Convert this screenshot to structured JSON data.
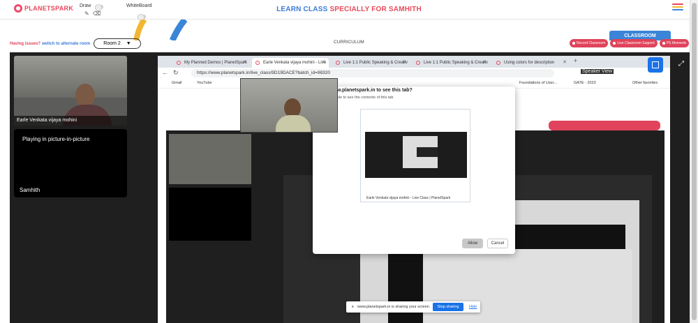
{
  "brand": {
    "name": "PLANETSPARK"
  },
  "toolbar": {
    "draw_label": "Draw",
    "whiteboard_label": "WhiteBoard"
  },
  "header": {
    "title_part1": "LEARN CLASS",
    "title_part2": "SPECIALLY FOR SAMHITH"
  },
  "subbar": {
    "issue_text": "Having issues?",
    "issue_link": "switch to alternate room",
    "room_select": "Room 2",
    "curriculum": "CURRICULUM",
    "classroom_tab": "CLASSROOM",
    "buttons": [
      "Record Classroom",
      "Live Classroom Support",
      "PS Moments"
    ]
  },
  "participants": [
    {
      "name": "Earle Venkata vijaya mohini"
    },
    {
      "status": "Playing in picture-in-picture",
      "name": "Samhith"
    }
  ],
  "browser": {
    "tabs": [
      {
        "label": "My Planned Demos | PlanetSpark"
      },
      {
        "label": "Earle Venkata vijaya mohini - Live"
      },
      {
        "label": "Live 1:1 Public Speaking & Creativ"
      },
      {
        "label": "Live 1:1 Public Speaking & Creativ"
      },
      {
        "label": "Using colors for description"
      }
    ],
    "url": "https://www.planetspark.in/live_class/9D19DACE?batch_id=98320",
    "bookmarks": [
      "Gmail",
      "YouTube",
      "Foundations of User...",
      "GATE - 2023",
      "Other favorites"
    ],
    "speaker_view": "Speaker View"
  },
  "dialog": {
    "heading": "www.planetspark.in to see this tab?",
    "sub": "be able to see the contents of this tab",
    "preview_caption": "Earle Venkata vijaya mohini - Live Class | PlanetSpark",
    "allow": "Allow",
    "cancel": "Cancel"
  },
  "share_bar": {
    "text": "www.planetspark.in is sharing your screen.",
    "stop": "Stop sharing",
    "hide": "Hide"
  },
  "colors": {
    "accent_red": "#e0435b",
    "accent_blue": "#3a85d8",
    "chrome_blue": "#1a73e8"
  }
}
